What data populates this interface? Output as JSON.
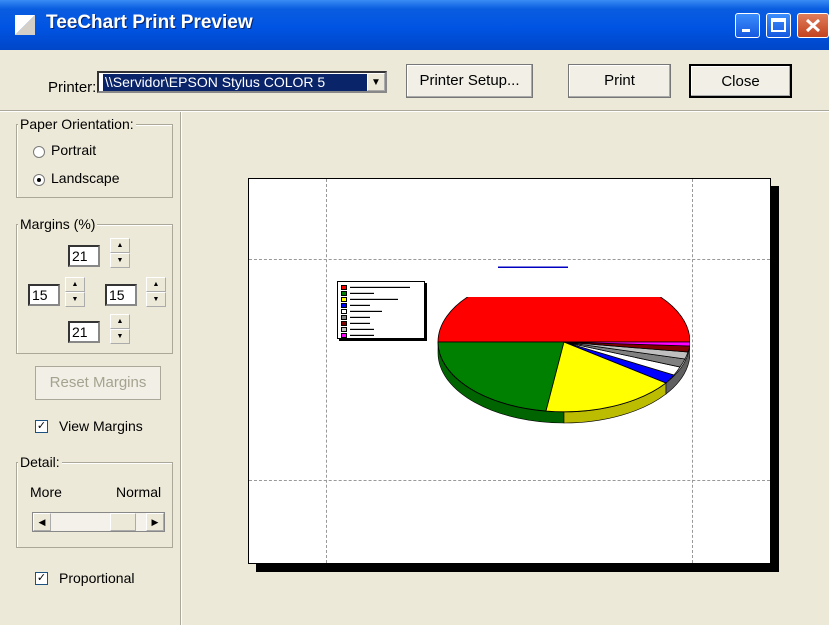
{
  "window": {
    "title": "TeeChart Print Preview"
  },
  "toolbar": {
    "printer_label": "Printer:",
    "printer_value": "\\\\Servidor\\EPSON Stylus COLOR 5",
    "setup_label": "Printer Setup...",
    "print_label": "Print",
    "close_label": "Close"
  },
  "orientation": {
    "group_label": "Paper Orientation:",
    "portrait_label": "Portrait",
    "landscape_label": "Landscape",
    "selected": "Landscape"
  },
  "margins": {
    "group_label": "Margins (%)",
    "top": "21",
    "left": "15",
    "right": "15",
    "bottom": "21"
  },
  "reset_label": "Reset Margins",
  "view_margins": {
    "label": "View Margins",
    "checked": true
  },
  "detail": {
    "group_label": "Detail:",
    "more_label": "More",
    "normal_label": "Normal",
    "level": 0.85
  },
  "proportional": {
    "label": "Proportional",
    "checked": true
  },
  "chart_data": {
    "type": "pie",
    "colors": [
      "#ff0000",
      "#008000",
      "#ffff00",
      "#0000ff",
      "#ffffff",
      "#808080",
      "#800000",
      "#c0c0c0",
      "#ff00ff"
    ]
  }
}
